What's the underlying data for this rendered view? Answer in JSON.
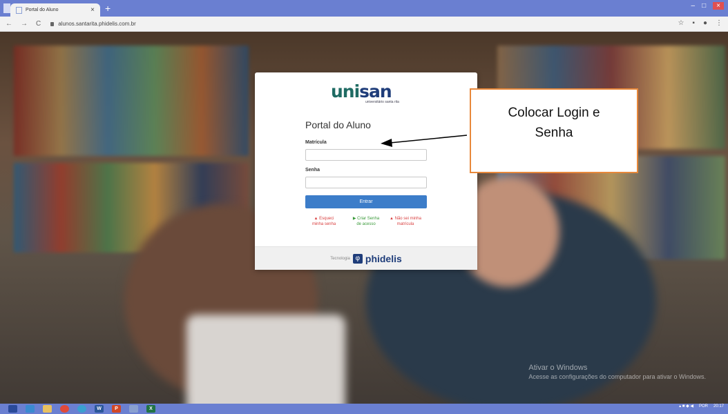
{
  "browser": {
    "tab_title": "Portal do Aluno",
    "tab_close": "×",
    "new_tab": "+",
    "url": "alunos.santarita.phidelis.com.br",
    "window_controls": {
      "minimize": "–",
      "maximize": "□",
      "close": "×"
    },
    "nav": {
      "back": "←",
      "forward": "→",
      "reload": "C"
    },
    "toolbar_icons": {
      "star": "☆",
      "menu": "⋮"
    }
  },
  "login": {
    "logo_main": "unisan",
    "logo_sub": "universitário santa rita",
    "title": "Portal do Aluno",
    "matricula_label": "Matrícula",
    "senha_label": "Senha",
    "submit_label": "Entrar",
    "links": {
      "forgot_password": "Esqueci minha senha",
      "create_password": "Criar Senha de acesso",
      "no_enrollment": "Não sei minha matrícula"
    },
    "footer_prefix": "Tecnologia",
    "footer_brand": "phidelis"
  },
  "annotation": {
    "text_line1": "Colocar Login e",
    "text_line2": "Senha"
  },
  "watermark": {
    "title": "Ativar o Windows",
    "subtitle": "Acesse as configurações do computador para ativar o Windows."
  },
  "taskbar": {
    "word_label": "W",
    "ppt_label": "P",
    "excel_label": "X",
    "language": "POR",
    "time": "20:17"
  },
  "colors": {
    "accent": "#3c7dc9",
    "annotation_border": "#e8883a",
    "taskbar": "#6a7fd1",
    "logo_teal": "#1f6b63",
    "logo_navy": "#1f3d7a"
  }
}
